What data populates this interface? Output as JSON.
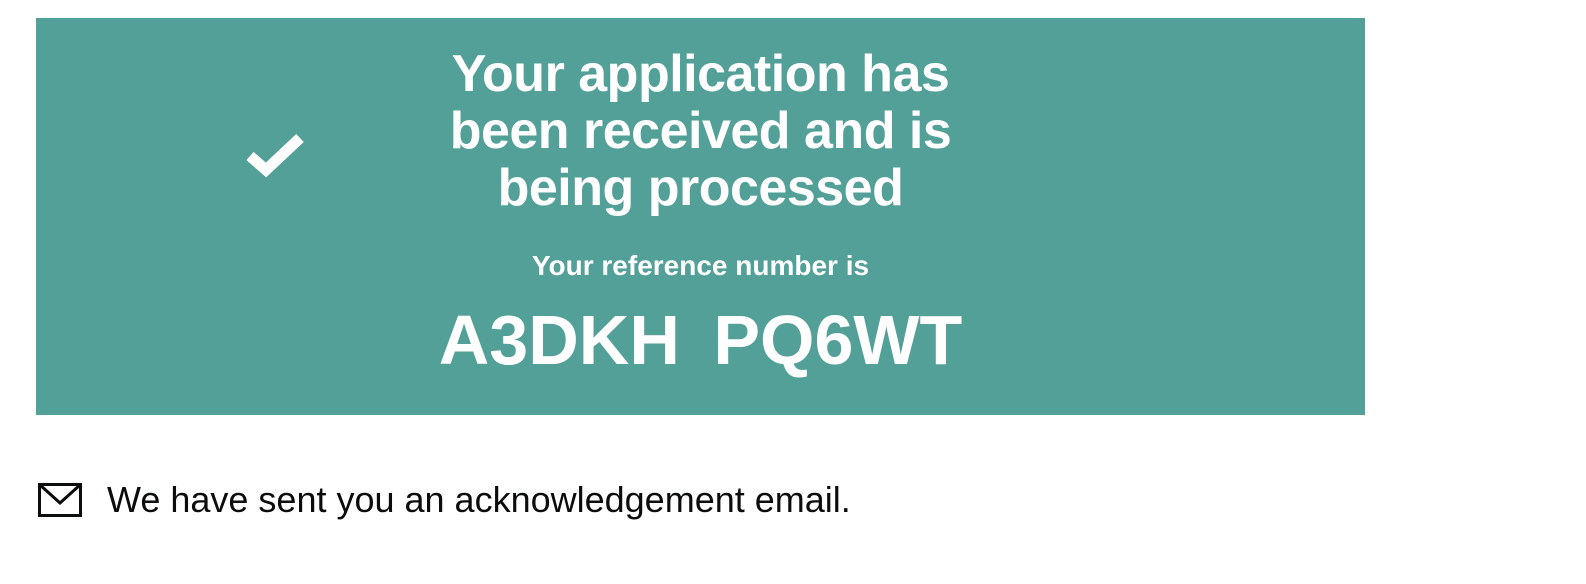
{
  "confirmation_panel": {
    "title_lines": [
      "Your application has",
      "been received and is",
      "being processed"
    ],
    "reference_label": "Your reference number is",
    "reference_number": "A3DKH PQ6WT",
    "icon": "check-icon",
    "background_color": "#52a097"
  },
  "email_notice": {
    "icon": "mail-icon",
    "text": "We have sent you an acknowledgement email."
  }
}
